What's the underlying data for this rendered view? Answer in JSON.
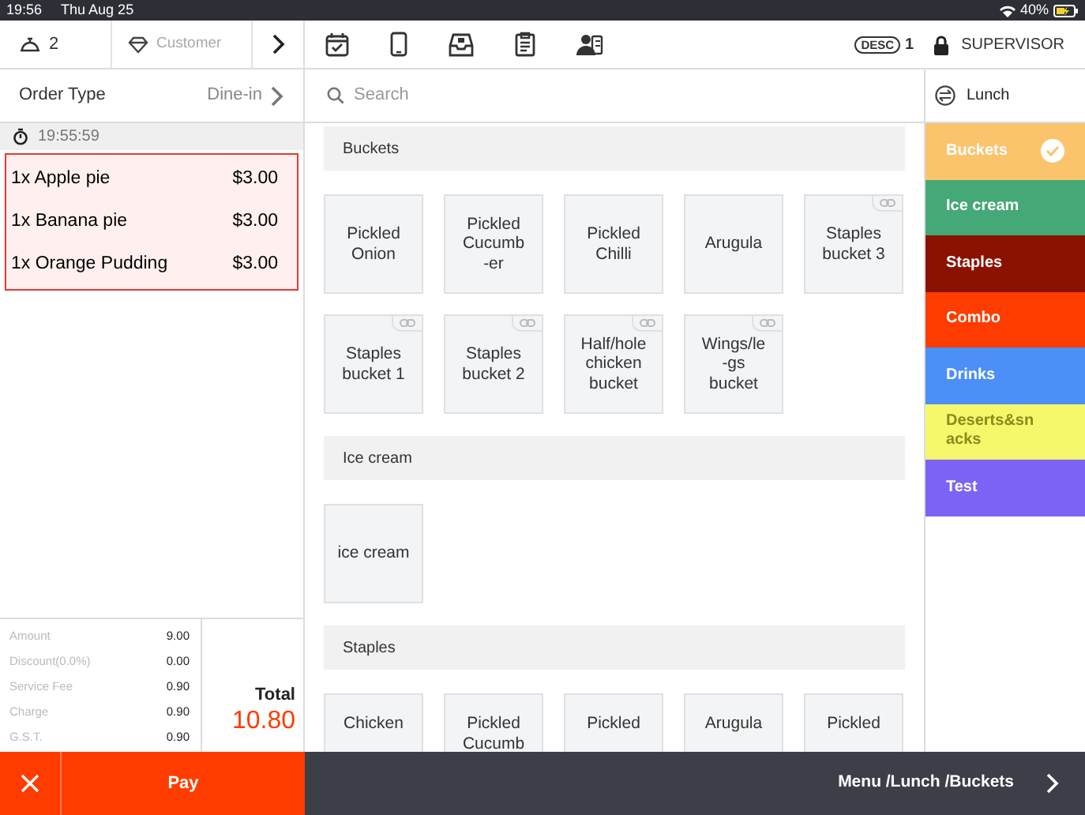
{
  "status_bar": {
    "time": "19:56",
    "date": "Thu Aug 25",
    "battery": "40%"
  },
  "toolbar": {
    "guests": "2",
    "customer": "Customer",
    "desc_badge": "DESC",
    "desc_count": "1",
    "user": "SUPERVISOR"
  },
  "order": {
    "type_label": "Order Type",
    "type_value": "Dine-in",
    "time": "19:55:59",
    "items": [
      {
        "text": "1x Apple pie",
        "price": "$3.00"
      },
      {
        "text": "1x Banana pie",
        "price": "$3.00"
      },
      {
        "text": "1x Orange Pudding",
        "price": "$3.00"
      }
    ]
  },
  "summary": {
    "rows": [
      {
        "label": "Amount",
        "value": "9.00"
      },
      {
        "label": "Discount(0.0%)",
        "value": "0.00"
      },
      {
        "label": "Service Fee",
        "value": "0.90"
      },
      {
        "label": "Charge",
        "value": "0.90"
      },
      {
        "label": "G.S.T.",
        "value": "0.90"
      }
    ],
    "total_label": "Total",
    "total": "10.80"
  },
  "pay": "Pay",
  "search": {
    "placeholder": "Search"
  },
  "sections": [
    {
      "title": "Buckets",
      "tiles": [
        {
          "text": "Pickled\nOnion",
          "linked": false
        },
        {
          "text": "Pickled\nCucumb\n-er",
          "linked": false
        },
        {
          "text": "Pickled\nChilli",
          "linked": false
        },
        {
          "text": "Arugula",
          "linked": false
        },
        {
          "text": "Staples\nbucket  3",
          "linked": true
        },
        {
          "text": "Staples\nbucket  1",
          "linked": true
        },
        {
          "text": "Staples\nbucket  2",
          "linked": true
        },
        {
          "text": "Half/hole\nchicken\nbucket",
          "linked": true
        },
        {
          "text": "Wings/le\n-gs\nbucket",
          "linked": true
        }
      ]
    },
    {
      "title": "Ice cream",
      "tiles": [
        {
          "text": "ice  cream",
          "linked": false
        }
      ]
    },
    {
      "title": "Staples",
      "tiles": [
        {
          "text": "Chicken",
          "linked": false
        },
        {
          "text": "Pickled\nCucumb",
          "linked": false
        },
        {
          "text": "Pickled",
          "linked": false
        },
        {
          "text": "Arugula",
          "linked": false
        },
        {
          "text": "Pickled",
          "linked": false
        }
      ]
    }
  ],
  "menu": {
    "title": "Lunch",
    "categories": [
      {
        "label": "Buckets",
        "color": "#fbc36b",
        "selected": true
      },
      {
        "label": "Ice cream",
        "color": "#45a877",
        "selected": false
      },
      {
        "label": "Staples",
        "color": "#8b1200",
        "selected": false
      },
      {
        "label": "Combo",
        "color": "#ff3c00",
        "selected": false
      },
      {
        "label": "Drinks",
        "color": "#4b8ff7",
        "selected": false
      },
      {
        "label": "Deserts&snacks",
        "color": "#f5f86a",
        "selected": false
      },
      {
        "label": "Test",
        "color": "#7c63f5",
        "selected": false
      }
    ]
  },
  "breadcrumb": "Menu /Lunch /Buckets"
}
